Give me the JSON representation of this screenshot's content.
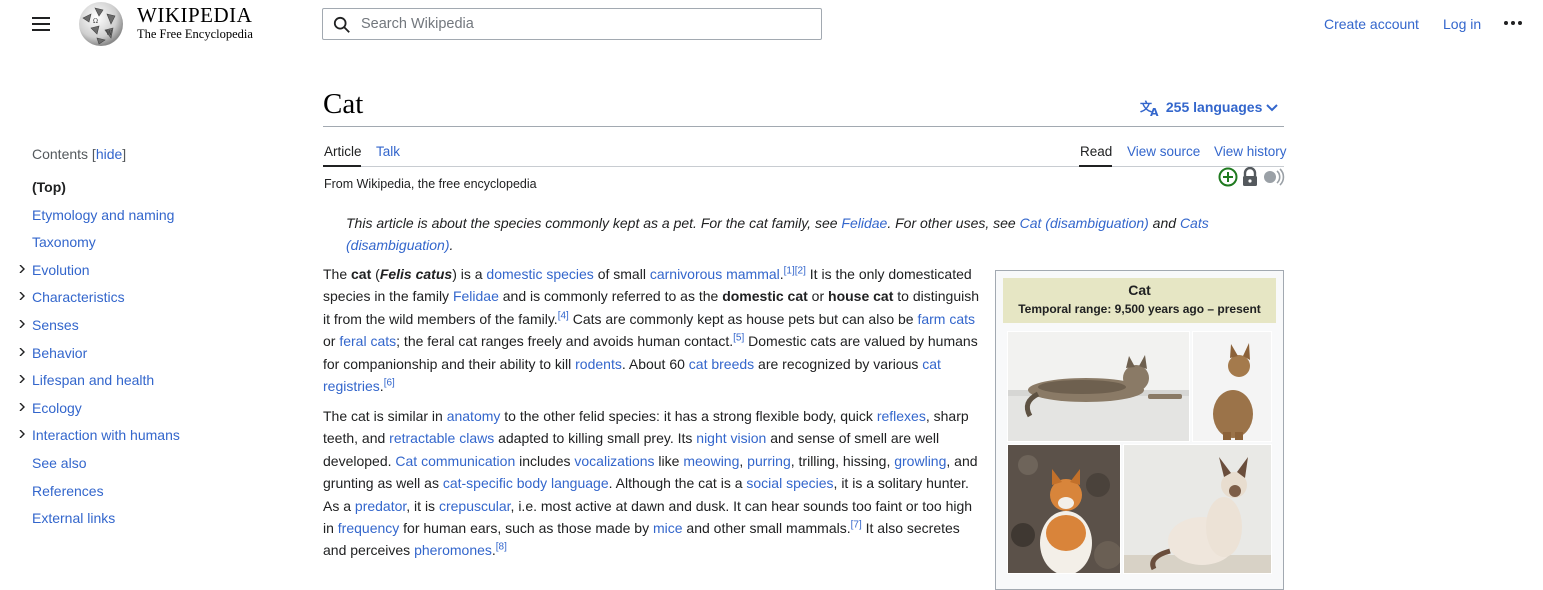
{
  "header": {
    "wordmark": "WIKIPEDIA",
    "tagline": "The Free Encyclopedia",
    "search_placeholder": "Search Wikipedia",
    "create_account": "Create account",
    "log_in": "Log in"
  },
  "toc": {
    "title": "Contents",
    "hide": "hide",
    "items": [
      {
        "label": "(Top)",
        "expandable": false
      },
      {
        "label": "Etymology and naming",
        "expandable": false
      },
      {
        "label": "Taxonomy",
        "expandable": false
      },
      {
        "label": "Evolution",
        "expandable": true
      },
      {
        "label": "Characteristics",
        "expandable": true
      },
      {
        "label": "Senses",
        "expandable": true
      },
      {
        "label": "Behavior",
        "expandable": true
      },
      {
        "label": "Lifespan and health",
        "expandable": true
      },
      {
        "label": "Ecology",
        "expandable": true
      },
      {
        "label": "Interaction with humans",
        "expandable": true
      },
      {
        "label": "See also",
        "expandable": false
      },
      {
        "label": "References",
        "expandable": false
      },
      {
        "label": "External links",
        "expandable": false
      }
    ]
  },
  "article": {
    "title": "Cat",
    "languages": "255 languages",
    "tabs": {
      "article": "Article",
      "talk": "Talk",
      "read": "Read",
      "view_source": "View source",
      "view_history": "View history"
    },
    "from": "From Wikipedia, the free encyclopedia",
    "hatnote": {
      "t1": "This article is about the species commonly kept as a pet. For the cat family, see ",
      "l1": "Felidae",
      "t2": ". For other uses, see ",
      "l2": "Cat (disambiguation)",
      "t3": " and ",
      "l3": "Cats (disambiguation)",
      "t4": "."
    },
    "p1": {
      "a": "The ",
      "b": "cat",
      "c": " (",
      "d": "Felis catus",
      "e": ") is a ",
      "l1": "domestic species",
      "f": " of small ",
      "l2": "carnivorous mammal",
      "f2": ".",
      "r1": "[1]",
      "r2": "[2]",
      "g": " It is the only domesticated species in the family ",
      "l3": "Felidae",
      "h": " and is commonly referred to as the ",
      "i": "domestic cat",
      "j": " or ",
      "k": "house cat",
      "m": " to distinguish it from the wild members of the family.",
      "r4": "[4]",
      "n": " Cats are commonly kept as house pets but can also be ",
      "l4": "farm cats",
      "o": " or ",
      "l5": "feral cats",
      "p": "; the feral cat ranges freely and avoids human contact.",
      "r5": "[5]",
      "q": " Domestic cats are valued by humans for companionship and their ability to kill ",
      "l6": "rodents",
      "s": ". About 60 ",
      "l7": "cat breeds",
      "t": " are recognized by various ",
      "l8": "cat registries",
      "u": ".",
      "r6": "[6]"
    },
    "p2": {
      "a": "The cat is similar in ",
      "l1": "anatomy",
      "b": " to the other felid species: it has a strong flexible body, quick ",
      "l2": "reflexes",
      "c": ", sharp teeth, and ",
      "l3": "retractable claws",
      "d": " adapted to killing small prey. Its ",
      "l4": "night vision",
      "e": " and sense of smell are well developed. ",
      "l5": "Cat communication",
      "f": " includes ",
      "l6": "vocalizations",
      "g": " like ",
      "l7": "meowing",
      "h": ", ",
      "l8": "purring",
      "i": ", trilling, hissing, ",
      "l9": "growling",
      "j": ", and grunting as well as ",
      "l10": "cat-specific body language",
      "k": ". Although the cat is a ",
      "l11": "social species",
      "m": ", it is a solitary hunter. As a ",
      "l12": "predator",
      "n": ", it is ",
      "l13": "crepuscular",
      "o": ", i.e. most active at dawn and dusk. It can hear sounds too faint or too high in ",
      "l14": "frequency",
      "p": " for human ears, such as those made by ",
      "l15": "mice",
      "q": " and other small mammals.",
      "r7": "[7]",
      "s": " It also secretes and perceives ",
      "l16": "pheromones",
      "t": ".",
      "r8": "[8]"
    }
  },
  "infobox": {
    "title": "Cat",
    "range": "Temporal range: 9,500 years ago – present"
  }
}
